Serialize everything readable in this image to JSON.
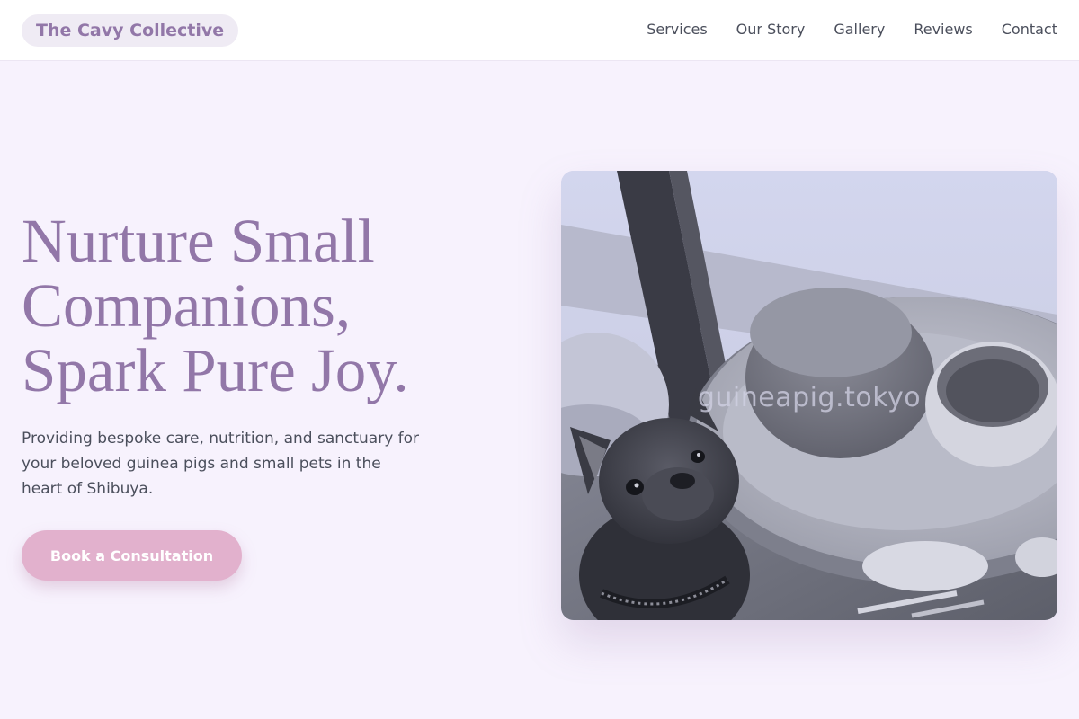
{
  "header": {
    "logo": "The Cavy Collective",
    "nav": [
      "Services",
      "Our Story",
      "Gallery",
      "Reviews",
      "Contact"
    ]
  },
  "hero": {
    "title_lines": [
      "Nurture Small",
      "Companions,",
      "Spark Pure Joy."
    ],
    "subtitle": "Providing bespoke care, nutrition, and sanctuary for your beloved guinea pigs and small pets in the heart of Shibuya.",
    "cta_label": "Book a Consultation"
  },
  "photo": {
    "watermark": "guineapig.tokyo"
  },
  "colors": {
    "background": "#f7f2fd",
    "brand": "#9277a8",
    "cta": "#e2b1cd",
    "text": "#4b4f5c"
  }
}
